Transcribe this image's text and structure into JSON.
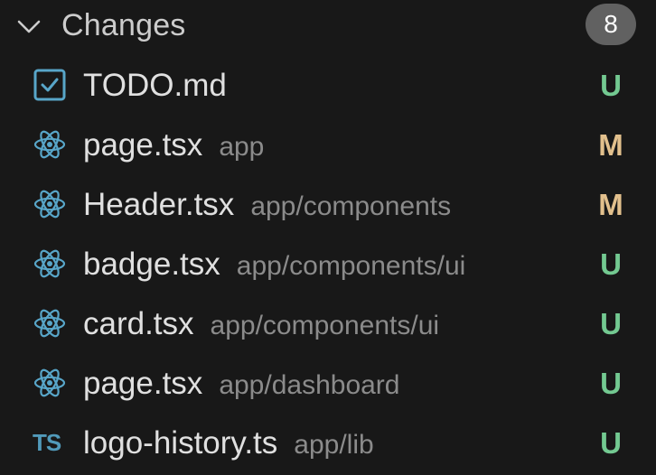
{
  "section": {
    "title": "Changes",
    "count": "8"
  },
  "files": [
    {
      "name": "TODO.md",
      "dir": "",
      "status": "U",
      "icon": "checkbox-icon"
    },
    {
      "name": "page.tsx",
      "dir": "app",
      "status": "M",
      "icon": "react-icon"
    },
    {
      "name": "Header.tsx",
      "dir": "app/components",
      "status": "M",
      "icon": "react-icon"
    },
    {
      "name": "badge.tsx",
      "dir": "app/components/ui",
      "status": "U",
      "icon": "react-icon"
    },
    {
      "name": "card.tsx",
      "dir": "app/components/ui",
      "status": "U",
      "icon": "react-icon"
    },
    {
      "name": "page.tsx",
      "dir": "app/dashboard",
      "status": "U",
      "icon": "react-icon"
    },
    {
      "name": "logo-history.ts",
      "dir": "app/lib",
      "status": "U",
      "icon": "typescript-icon",
      "icon_text": "TS"
    }
  ],
  "colors": {
    "untracked": "#73c991",
    "modified": "#e2c08d",
    "react": "#58a6c9",
    "typescript": "#519aba"
  }
}
